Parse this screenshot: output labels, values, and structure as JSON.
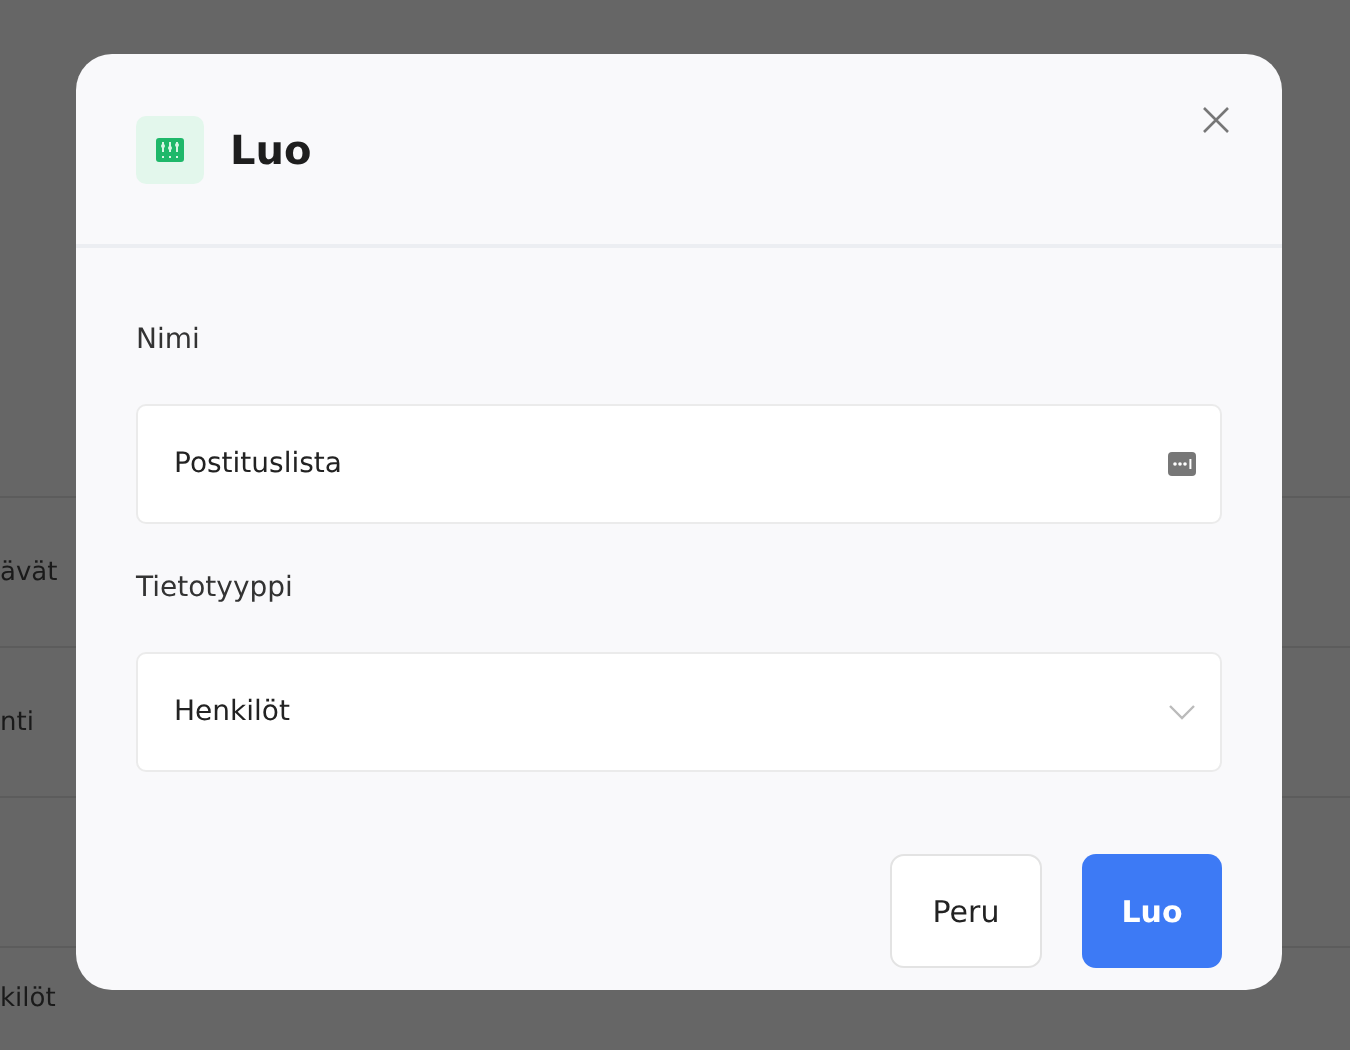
{
  "background_rows": [
    {
      "text": "ävät"
    },
    {
      "text": "nti"
    },
    {},
    {
      "text": "kilöt"
    }
  ],
  "dialog": {
    "title": "Luo",
    "fields": [
      {
        "kind": "text",
        "label": "Nimi",
        "value": "Postituslista"
      },
      {
        "kind": "select",
        "label": "Tietotyyppi",
        "value": "Henkilöt"
      }
    ],
    "buttons": [
      {
        "kind": "secondary",
        "label": "Peru"
      },
      {
        "kind": "primary",
        "label": "Luo"
      }
    ]
  }
}
